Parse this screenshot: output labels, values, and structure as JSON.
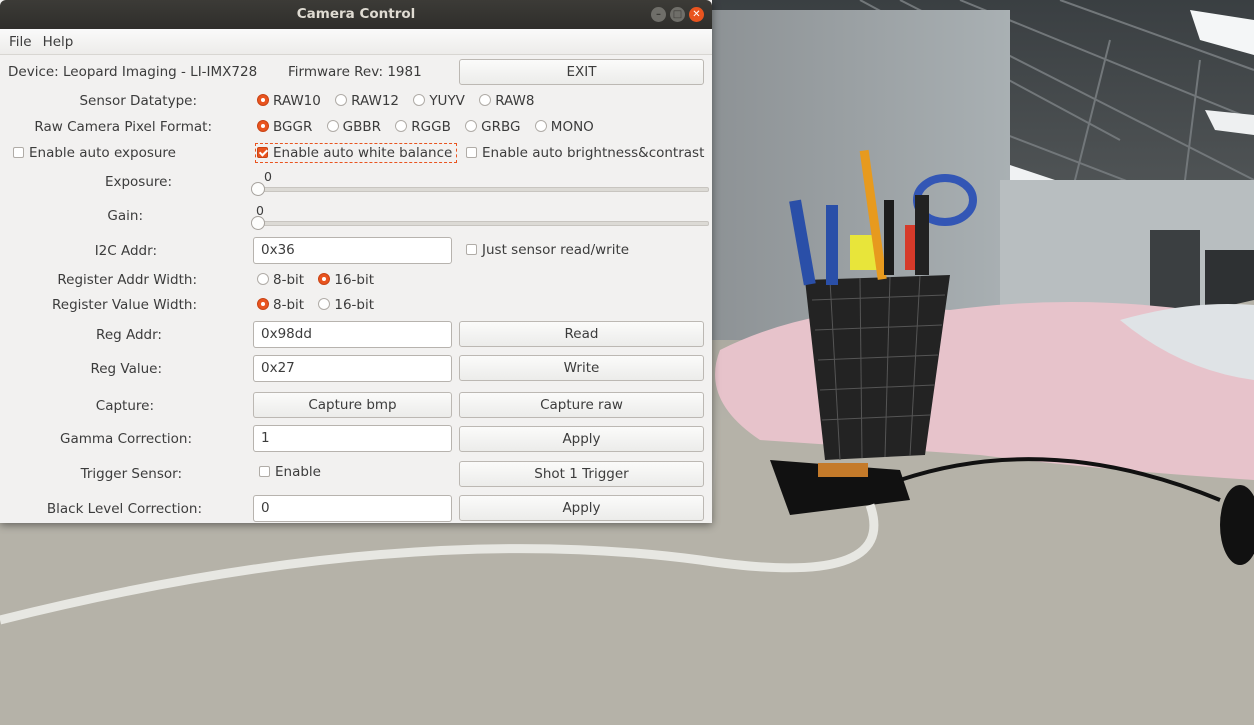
{
  "window": {
    "title": "Camera Control"
  },
  "caption_top": "                                                      ",
  "menu": [
    "File",
    "Help"
  ],
  "info": {
    "device": "Device: Leopard Imaging - LI-IMX728",
    "firmware": "Firmware Rev: 1981",
    "exit_label": "EXIT"
  },
  "sensor_datatype": {
    "label": "Sensor Datatype:",
    "options": [
      "RAW10",
      "RAW12",
      "YUYV",
      "RAW8"
    ],
    "selected": "RAW10"
  },
  "pixel_format": {
    "label": "Raw Camera Pixel Format:",
    "options": [
      "BGGR",
      "GBBR",
      "RGGB",
      "GRBG",
      "MONO"
    ],
    "selected": "BGGR"
  },
  "checks": {
    "auto_exposure": "Enable auto exposure",
    "auto_white_balance": "Enable auto white balance",
    "auto_brightness": "Enable auto brightness&contrast"
  },
  "exposure": {
    "label": "Exposure:",
    "value": "0"
  },
  "gain": {
    "label": "Gain:",
    "value": "0"
  },
  "i2c": {
    "label": "I2C Addr:",
    "value": "0x36",
    "just_sensor": "Just sensor read/write"
  },
  "reg_addr_width": {
    "label": "Register Addr Width:",
    "options": [
      "8-bit",
      "16-bit"
    ],
    "selected": "16-bit"
  },
  "reg_val_width": {
    "label": "Register Value Width:",
    "options": [
      "8-bit",
      "16-bit"
    ],
    "selected": "8-bit"
  },
  "reg_addr": {
    "label": "Reg Addr:",
    "value": "0x98dd",
    "button": "Read"
  },
  "reg_value": {
    "label": "Reg Value:",
    "value": "0x27",
    "button": "Write"
  },
  "capture": {
    "label": "Capture:",
    "bmp": "Capture bmp",
    "raw": "Capture raw"
  },
  "gamma": {
    "label": "Gamma Correction:",
    "value": "1",
    "button": "Apply"
  },
  "trigger": {
    "label": "Trigger Sensor:",
    "enable": "Enable",
    "button": "Shot 1 Trigger"
  },
  "black_level": {
    "label": "Black Level Correction:",
    "value": "0",
    "button": "Apply"
  },
  "colors": {
    "accent": "#e9541f",
    "titlebar": "#3c3b37",
    "dialog_bg": "#f2f1f0"
  }
}
